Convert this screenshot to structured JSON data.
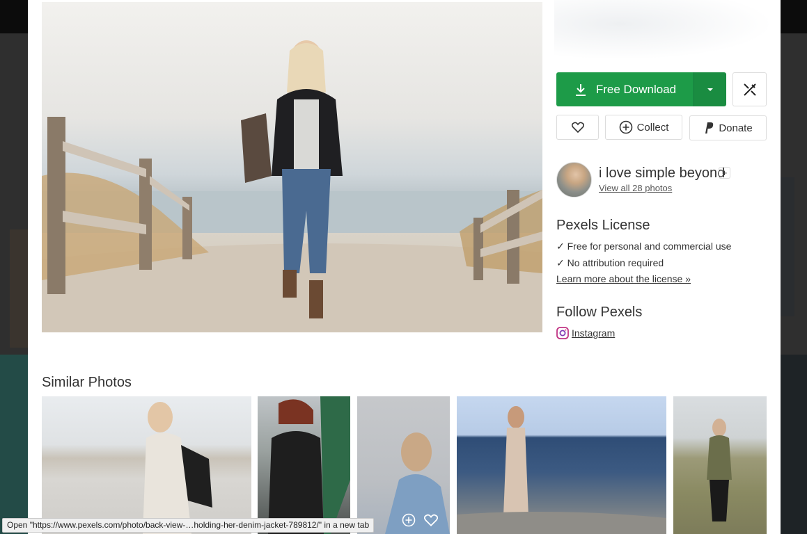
{
  "colors": {
    "download_green": "#1d9b48",
    "text": "#333333"
  },
  "download": {
    "label": "Free Download",
    "icon": "download-icon",
    "caret_icon": "caret-down-icon"
  },
  "edit": {
    "icon": "edit-magic-icon"
  },
  "actions": {
    "like_icon": "heart-icon",
    "collect_label": "Collect",
    "collect_icon": "plus-circle-icon",
    "donate_label": "Donate",
    "donate_icon": "paypal-icon"
  },
  "author": {
    "name": "i love simple beyond",
    "follow": "+",
    "view_all": "View all 28 photos"
  },
  "license": {
    "title": "Pexels License",
    "check1": "✓ Free for personal and commercial use",
    "check2": "✓ No attribution required",
    "learn_more": "Learn more about the license »"
  },
  "follow": {
    "title": "Follow Pexels",
    "instagram": "Instagram",
    "instagram_icon": "instagram-icon"
  },
  "similar": {
    "title": "Similar Photos"
  },
  "statusbar": {
    "text": "Open \"https://www.pexels.com/photo/back-view-…holding-her-denim-jacket-789812/\" in a new tab"
  }
}
